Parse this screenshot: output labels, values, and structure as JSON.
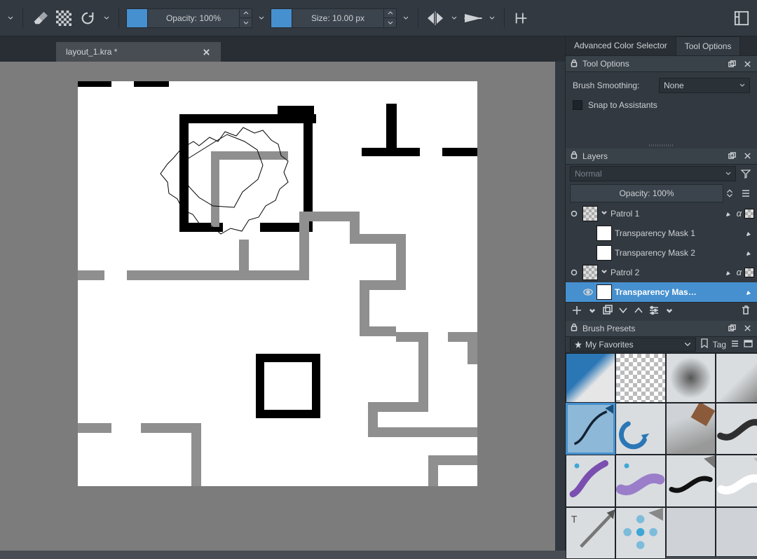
{
  "toolbar": {
    "opacity_label": "Opacity: 100%",
    "size_label": "Size: 10.00 px"
  },
  "document": {
    "tab_title": "layout_1.kra *"
  },
  "dock_tabs": {
    "color": "Advanced Color Selector",
    "tool": "Tool Options"
  },
  "tool_options": {
    "title": "Tool Options",
    "smoothing_label": "Brush Smoothing:",
    "smoothing_value": "None",
    "snap_label": "Snap to Assistants"
  },
  "layers": {
    "title": "Layers",
    "blend_mode": "Normal",
    "opacity_label": "Opacity:  100%",
    "items": [
      {
        "name": "Patrol 1",
        "indent": false,
        "selected": false,
        "expand": true,
        "thumb": "pattern"
      },
      {
        "name": "Transparency Mask 1",
        "indent": true,
        "selected": false,
        "thumb": "mask"
      },
      {
        "name": "Transparency Mask 2",
        "indent": true,
        "selected": false,
        "thumb": "mask"
      },
      {
        "name": "Patrol 2",
        "indent": false,
        "selected": false,
        "expand": true,
        "thumb": "pattern"
      },
      {
        "name": "Transparency Mas…",
        "indent": true,
        "selected": true,
        "visible": true,
        "thumb": "mask"
      }
    ]
  },
  "brush_presets": {
    "title": "Brush Presets",
    "tag_label": "Tag",
    "favorites_label": "My Favorites"
  }
}
